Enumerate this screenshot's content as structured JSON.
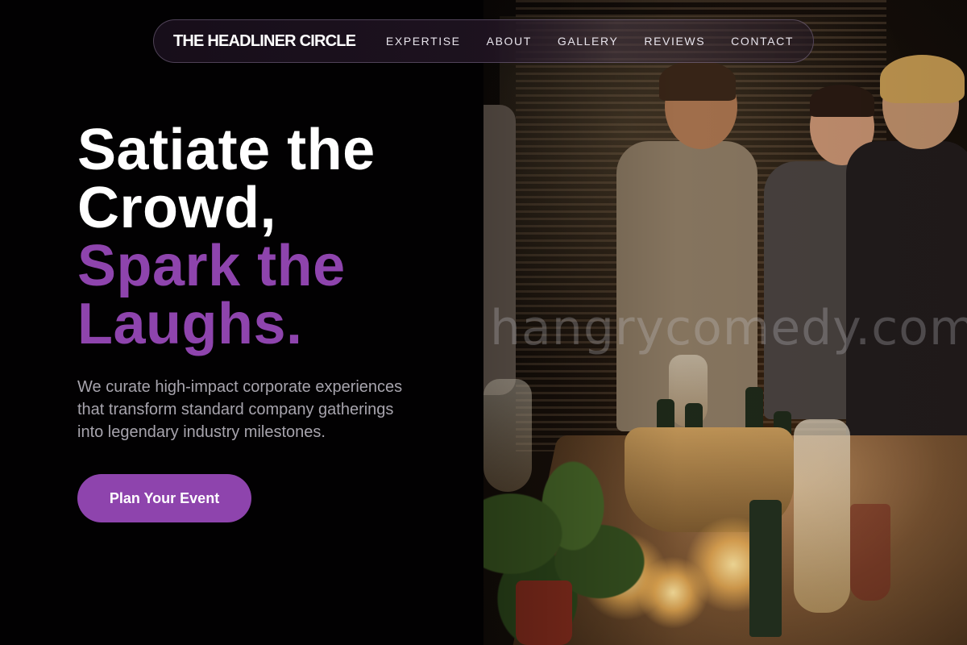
{
  "nav": {
    "brand": "THE HEADLINER CIRCLE",
    "links": [
      "EXPERTISE",
      "ABOUT",
      "GALLERY",
      "REVIEWS",
      "CONTACT"
    ]
  },
  "hero": {
    "headline_line1": "Satiate the",
    "headline_line2": "Crowd,",
    "headline_accent_line1": "Spark the",
    "headline_accent_line2": "Laughs.",
    "subtext": "We curate high-impact corporate experiences that transform standard company gatherings into legendary industry milestones.",
    "cta_label": "Plan Your Event"
  },
  "photo": {
    "watermark": "hangrycomedy.com"
  },
  "colors": {
    "accent": "#8e44ad",
    "background": "#020102",
    "subtext": "#a7a4ad"
  }
}
